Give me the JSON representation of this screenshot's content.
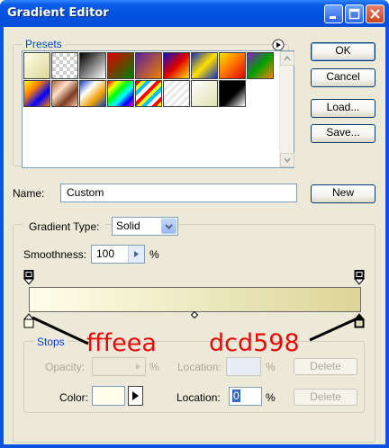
{
  "window": {
    "title": "Gradient Editor",
    "controls": {
      "minimize_icon": "minimize-icon",
      "maximize_icon": "maximize-icon",
      "close_icon": "close-icon"
    }
  },
  "presets": {
    "label": "Presets",
    "menu_icon": "flyout-menu-icon",
    "swatches": [
      {
        "bg": "linear-gradient(135deg,#fffeea,#dcd598)"
      },
      {
        "bg": "repeating-conic-gradient(#ffffff 0% 25%, #cfcfcf 0% 50%) 0 0/8px 8px"
      },
      {
        "bg": "linear-gradient(135deg,#000000,#ffffff)"
      },
      {
        "bg": "linear-gradient(135deg,#e00000,#008000)"
      },
      {
        "bg": "linear-gradient(135deg,#5a1ea0,#f08000)"
      },
      {
        "bg": "linear-gradient(135deg,#1010c0,#e00000,#ffe000)"
      },
      {
        "bg": "linear-gradient(135deg,#1030c0,#ffe000,#1030c0)"
      },
      {
        "bg": "linear-gradient(135deg,#ffe000,#ff7000,#e00000)"
      },
      {
        "bg": "linear-gradient(135deg,#8020c0,#00a000,#ff8000)"
      },
      {
        "bg": "linear-gradient(135deg,#ffff00,#ff8000,#0000ff,#ff8000)"
      },
      {
        "bg": "linear-gradient(135deg,#b0603a,#ffe0c8,#7a3a20,#f0c0a0)"
      },
      {
        "bg": "linear-gradient(135deg,#1040c0,#ffffff,#f0a000,#1040c0)"
      },
      {
        "bg": "linear-gradient(135deg,#ff0000,#ffff00,#00ff00,#00ffff,#0000ff,#ff00ff)"
      },
      {
        "bg": "repeating-linear-gradient(135deg,#ff0000 0 4px,#ffff00 4px 8px,#00c0ff 8px 12px,#ffffff 12px 16px)"
      },
      {
        "bg": "repeating-linear-gradient(135deg,#e8e8e8 0 3px,#ffffff 3px 6px)"
      },
      {
        "bg": "linear-gradient(135deg,#ffffff,#e0e0b0)"
      },
      {
        "bg": "linear-gradient(135deg,#000000 55%,#ffffff)"
      }
    ]
  },
  "buttons": {
    "ok": "OK",
    "cancel": "Cancel",
    "load": "Load...",
    "save": "Save...",
    "new": "New"
  },
  "name": {
    "label": "Name:",
    "value": "Custom"
  },
  "gradient_type": {
    "label": "Gradient Type:",
    "value": "Solid"
  },
  "smoothness": {
    "label": "Smoothness:",
    "value": "100",
    "unit": "%"
  },
  "gradient": {
    "start_color": "#fffeea",
    "end_color": "#dcd598",
    "midpoint_location": 50
  },
  "stops": {
    "label": "Stops",
    "opacity_label": "Opacity:",
    "opacity_value": "",
    "opacity_unit": "%",
    "opacity_location_label": "Location:",
    "opacity_location_value": "",
    "opacity_location_unit": "%",
    "opacity_delete": "Delete",
    "color_label": "Color:",
    "color_value": "#fffeea",
    "color_location_label": "Location:",
    "color_location_value": "0",
    "color_location_unit": "%",
    "color_delete": "Delete"
  },
  "annotations": {
    "left": "fffeea",
    "right": "dcd598",
    "color": "#e8080a"
  }
}
